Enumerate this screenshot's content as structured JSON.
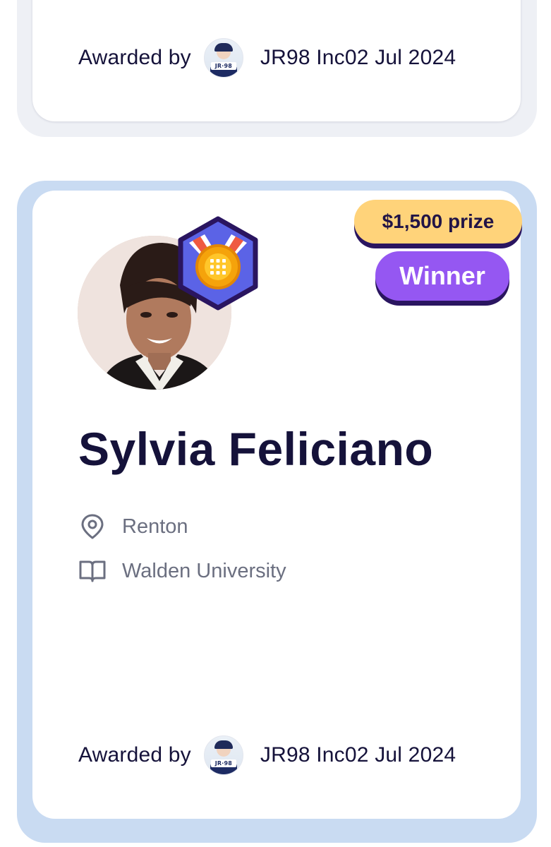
{
  "top_card": {
    "awarded_by_label": "Awarded by",
    "org_name": "JR98 Inc",
    "date": "02 Jul 2024",
    "org_avatar_text": "JR·98"
  },
  "winner_card": {
    "prize_label": "$1,500 prize",
    "status_label": "Winner",
    "name": "Sylvia Feliciano",
    "location": "Renton",
    "school": "Walden University",
    "awarded_by_label": "Awarded by",
    "org_name": "JR98 Inc",
    "date": "02 Jul 2024",
    "org_avatar_text": "JR·98",
    "location_icon": "map-pin-icon",
    "school_icon": "open-book-icon",
    "medal_icon": "medal-icon"
  },
  "colors": {
    "prize_bg": "#ffd37a",
    "winner_bg": "#9557f2",
    "card_border": "#c9dbf2",
    "text_dark": "#15123a",
    "text_muted": "#6b6f80"
  }
}
